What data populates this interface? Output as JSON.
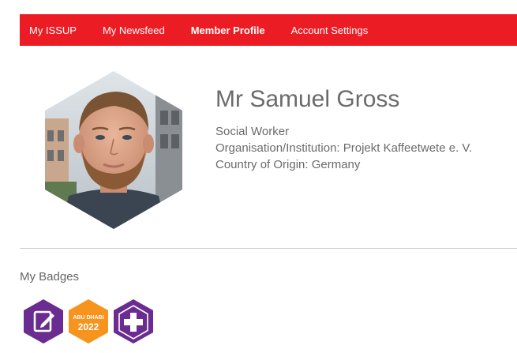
{
  "nav": {
    "items": [
      {
        "label": "My ISSUP",
        "active": false
      },
      {
        "label": "My Newsfeed",
        "active": false
      },
      {
        "label": "Member Profile",
        "active": true
      },
      {
        "label": "Account Settings",
        "active": false
      }
    ],
    "bar_color": "#ec1c24"
  },
  "profile": {
    "name": "Mr Samuel Gross",
    "occupation": "Social Worker",
    "organisation": "Organisation/Institution: Projekt Kaffeetwete e. V.",
    "country": "Country of Origin: Germany"
  },
  "badges": {
    "title": "My Badges",
    "items": [
      {
        "icon": "edit-note-icon",
        "color": "#6a2c91"
      },
      {
        "icon": "abu-dhabi-2022-icon",
        "color": "#f7941d",
        "line1": "ABU DHABI",
        "line2": "2022"
      },
      {
        "icon": "plus-icon",
        "color": "#6a2c91"
      }
    ]
  }
}
